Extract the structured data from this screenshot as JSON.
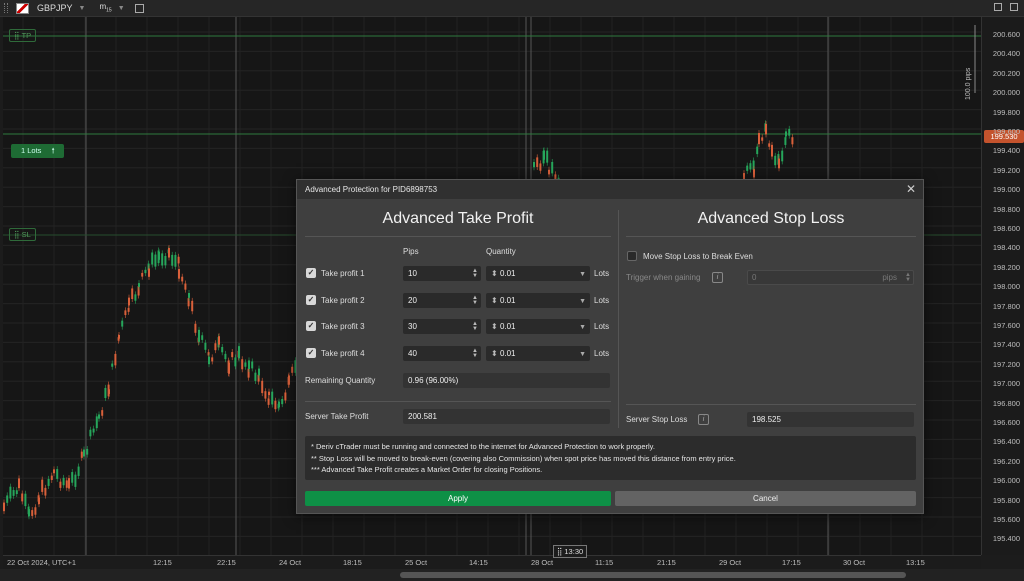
{
  "toolbar": {
    "symbol": "GBPJPY",
    "timeframe_main": "m",
    "timeframe_sub": "15"
  },
  "chart": {
    "price_ticks": [
      "200.600",
      "200.400",
      "200.200",
      "200.000",
      "199.800",
      "199.600",
      "199.400",
      "199.200",
      "199.000",
      "198.800",
      "198.600",
      "198.400",
      "198.200",
      "198.000",
      "197.800",
      "197.600",
      "197.400",
      "197.200",
      "197.000",
      "196.800",
      "196.600",
      "196.400",
      "196.200",
      "196.000",
      "195.800",
      "195.600",
      "195.400"
    ],
    "current_price": "199.530",
    "time_ticks": [
      "22 Oct 2024, UTC+1",
      "12:15",
      "22:15",
      "24 Oct",
      "18:15",
      "25 Oct",
      "14:15",
      "28 Oct",
      "11:15",
      "21:15",
      "29 Oct",
      "17:15",
      "30 Oct",
      "13:15"
    ],
    "crosshair_time": "13:30",
    "tp_label": "TP",
    "sl_label": "SL",
    "lots_label": "1 Lots",
    "pips_range": "100.0 pips",
    "colors": {
      "up": "#26a65b",
      "down": "#d9603a",
      "tp_line": "#2f7a3e"
    }
  },
  "dialog": {
    "title": "Advanced Protection for PID6898753",
    "take_profit": {
      "heading": "Advanced Take Profit",
      "col_pips": "Pips",
      "col_quantity": "Quantity",
      "lots_unit": "Lots",
      "rows": [
        {
          "label": "Take profit 1",
          "pips": "10",
          "quantity": "0.01",
          "checked": true
        },
        {
          "label": "Take profit 2",
          "pips": "20",
          "quantity": "0.01",
          "checked": true
        },
        {
          "label": "Take profit 3",
          "pips": "30",
          "quantity": "0.01",
          "checked": true
        },
        {
          "label": "Take profit 4",
          "pips": "40",
          "quantity": "0.01",
          "checked": true
        }
      ],
      "remaining_label": "Remaining Quantity",
      "remaining_value": "0.96 (96.00%)",
      "server_label": "Server Take Profit",
      "server_value": "200.581"
    },
    "stop_loss": {
      "heading": "Advanced Stop Loss",
      "break_even_label": "Move Stop Loss to Break Even",
      "break_even_checked": false,
      "trigger_label": "Trigger when gaining",
      "trigger_value": "0",
      "trigger_unit": "pips",
      "server_label": "Server Stop Loss",
      "server_value": "198.525"
    },
    "notes": [
      "* Deriv cTrader must be running and connected to the internet for Advanced Protection to work properly.",
      "** Stop Loss will be moved to break-even (covering also Commission) when spot price has moved this distance from entry price.",
      "*** Advanced Take Profit creates a Market Order for closing Positions."
    ],
    "apply_label": "Apply",
    "cancel_label": "Cancel"
  }
}
